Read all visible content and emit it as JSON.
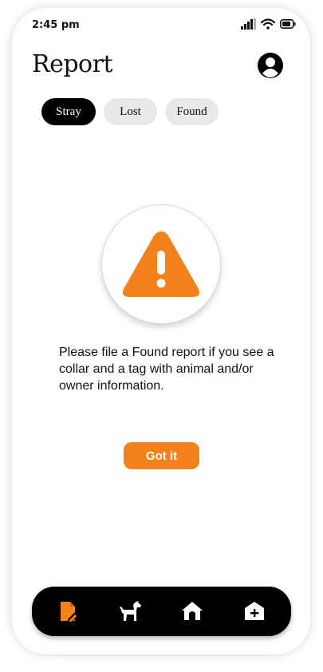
{
  "status_bar": {
    "time": "2:45 pm",
    "icons": [
      "signal-icon",
      "wifi-icon",
      "battery-icon"
    ]
  },
  "header": {
    "title": "Report",
    "profile_icon": "user-avatar-icon"
  },
  "tabs": [
    {
      "label": "Stray",
      "active": true
    },
    {
      "label": "Lost",
      "active": false
    },
    {
      "label": "Found",
      "active": false
    }
  ],
  "alert": {
    "icon": "warning-icon",
    "message": "Please file a Found report if you see a collar and a tag with animal and/or owner information.",
    "button_label": "Got it"
  },
  "bottom_nav": {
    "items": [
      {
        "icon": "report-icon",
        "active": true
      },
      {
        "icon": "dog-icon",
        "active": false
      },
      {
        "icon": "home-icon",
        "active": false
      },
      {
        "icon": "shelter-add-icon",
        "active": false
      }
    ]
  },
  "colors": {
    "accent": "#f3821d",
    "nav_background": "#000000",
    "tab_active": "#000000",
    "tab_inactive": "#e8e8e8"
  }
}
